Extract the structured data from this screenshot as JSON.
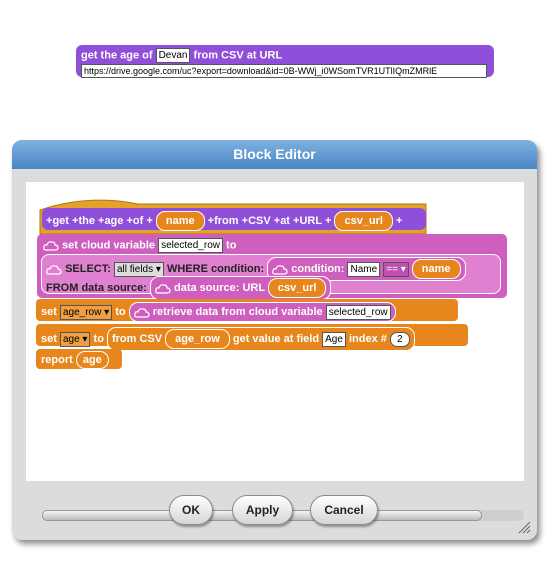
{
  "top_block": {
    "prefix": "get the age of",
    "name_value": "Devan",
    "suffix": "from CSV at URL",
    "url_value": "https://drive.google.com/uc?export=download&id=0B-WWj_i0WSomTVR1UTlIQmZMRlE"
  },
  "dialog": {
    "title": "Block Editor",
    "hat": {
      "words": [
        "get",
        "the",
        "age",
        "of"
      ],
      "param1": "name",
      "words2": [
        "from",
        "CSV",
        "at",
        "URL"
      ],
      "param2": "csv_url",
      "plus": "+"
    },
    "cloud_block": {
      "label": "set cloud variable",
      "var_value": "selected_row",
      "to": "to",
      "select_label": "SELECT:",
      "fields_dropdown": "all fields",
      "where_label": "WHERE condition:",
      "condition_label": "condition:",
      "cond_field": "Name",
      "cond_op": "==",
      "cond_value": "name",
      "from_label": "FROM data source:",
      "source_label": "data source: URL",
      "source_value": "csv_url"
    },
    "set1": {
      "set": "set",
      "var": "age_row",
      "to": "to",
      "retrieve_label": "retrieve data from cloud variable",
      "retrieve_value": "selected_row"
    },
    "set2": {
      "set": "set",
      "var": "age",
      "to": "to",
      "from_csv": "from CSV",
      "csv_var": "age_row",
      "get_label": "get value at field",
      "field_value": "Age",
      "index_label": "index #",
      "index_value": "2"
    },
    "report": {
      "label": "report",
      "value": "age"
    },
    "buttons": {
      "ok": "OK",
      "apply": "Apply",
      "cancel": "Cancel"
    }
  },
  "colors": {
    "purple": "#8f4fd8",
    "orange": "#e6861d",
    "pink": "#cf5fbf",
    "title_bar": "#4a86c6"
  }
}
